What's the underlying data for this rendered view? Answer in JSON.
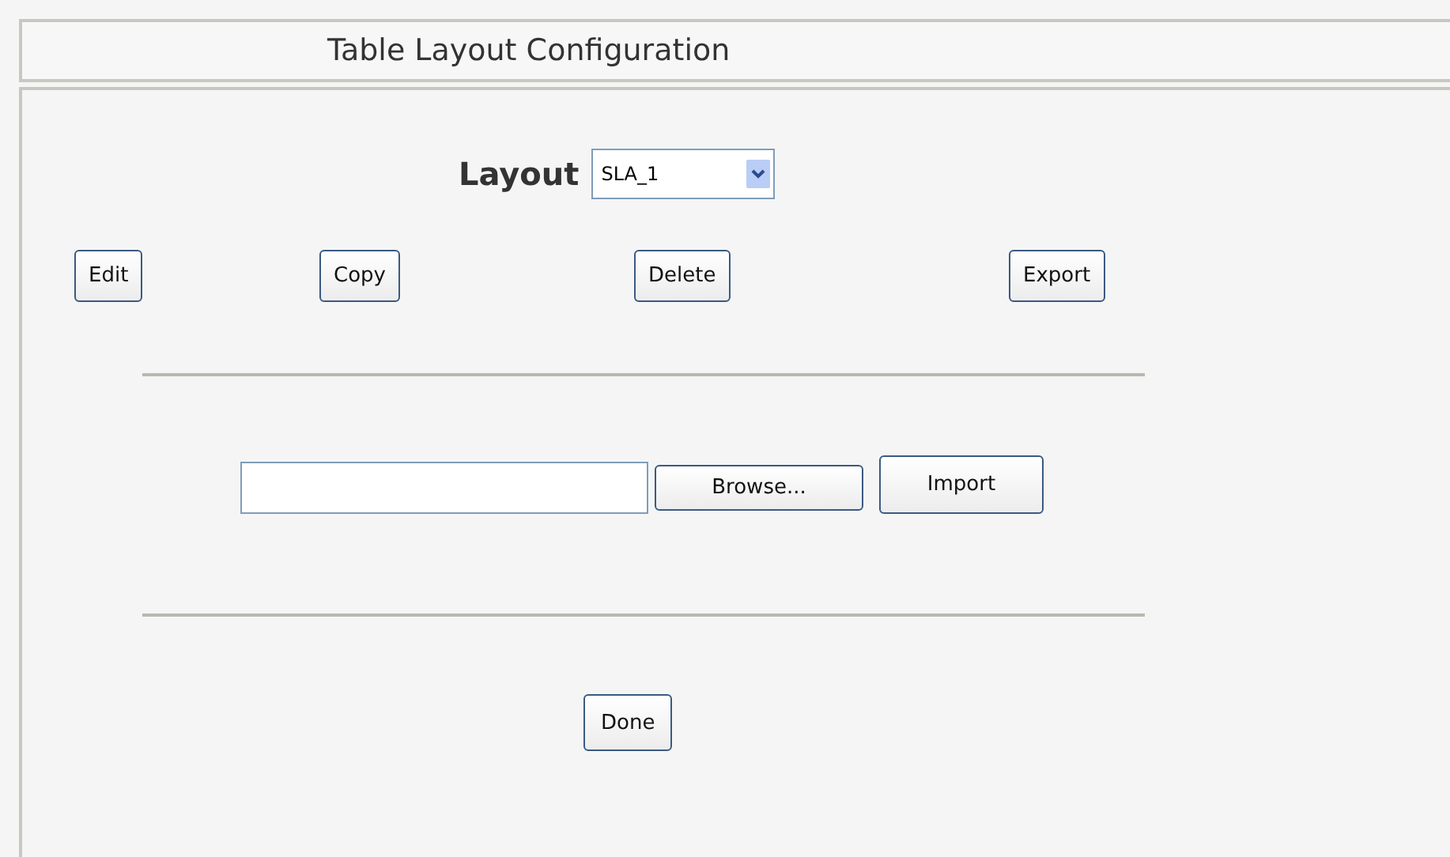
{
  "title": "Table Layout Configuration",
  "layout": {
    "label": "Layout",
    "value": "SLA_1"
  },
  "actions": [
    "Edit",
    "Copy",
    "Delete",
    "Export"
  ],
  "import": {
    "browse": "Browse...",
    "button": "Import"
  },
  "done": "Done"
}
